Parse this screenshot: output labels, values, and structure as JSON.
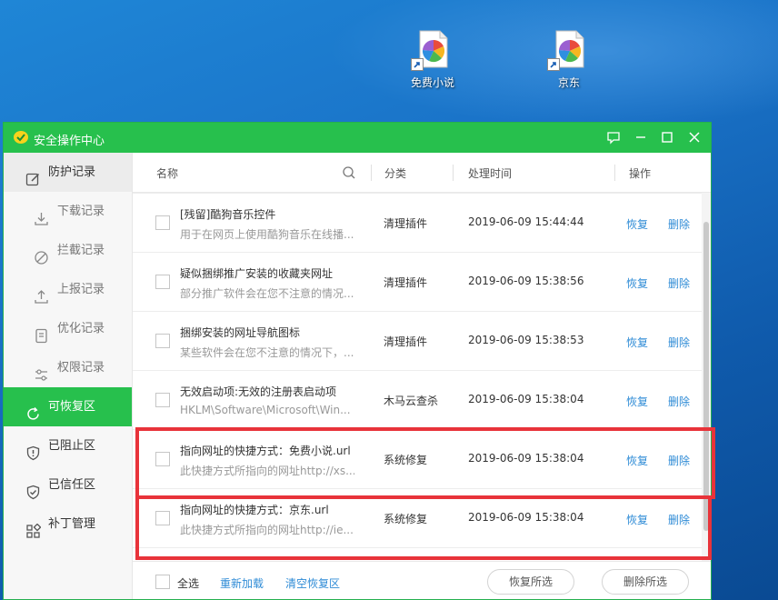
{
  "desktop": {
    "icons": [
      {
        "label": "免费小说"
      },
      {
        "label": "京东"
      }
    ]
  },
  "window": {
    "title": "安全操作中心"
  },
  "sidebar": {
    "items": [
      {
        "label": "防护记录",
        "icon": "shield-record-icon"
      },
      {
        "label": "下载记录",
        "icon": "download-icon"
      },
      {
        "label": "拦截记录",
        "icon": "block-icon"
      },
      {
        "label": "上报记录",
        "icon": "upload-icon"
      },
      {
        "label": "优化记录",
        "icon": "document-icon"
      },
      {
        "label": "权限记录",
        "icon": "sliders-icon"
      },
      {
        "label": "可恢复区",
        "icon": "restore-icon"
      },
      {
        "label": "已阻止区",
        "icon": "shield-alert-icon"
      },
      {
        "label": "已信任区",
        "icon": "shield-check-icon"
      },
      {
        "label": "补丁管理",
        "icon": "grid-icon"
      }
    ]
  },
  "table": {
    "headers": {
      "name": "名称",
      "category": "分类",
      "time": "处理时间",
      "action": "操作"
    },
    "restore_label": "恢复",
    "delete_label": "删除",
    "rows": [
      {
        "name": "[残留]酷狗音乐控件",
        "desc": "用于在网页上使用酷狗音乐在线播...",
        "category": "清理插件",
        "time": "2019-06-09 15:44:44"
      },
      {
        "name": "疑似捆绑推广安装的收藏夹网址",
        "desc": "部分推广软件会在您不注意的情况...",
        "category": "清理插件",
        "time": "2019-06-09 15:38:56"
      },
      {
        "name": "捆绑安装的网址导航图标",
        "desc": "某些软件会在您不注意的情况下，...",
        "category": "清理插件",
        "time": "2019-06-09 15:38:53"
      },
      {
        "name": "无效启动项:无效的注册表启动项",
        "desc": "HKLM\\Software\\Microsoft\\Win...",
        "category": "木马云查杀",
        "time": "2019-06-09 15:38:04"
      },
      {
        "name": "指向网址的快捷方式：免费小说.url",
        "desc": "此快捷方式所指向的网址http://xs....",
        "category": "系统修复",
        "time": "2019-06-09 15:38:04"
      },
      {
        "name": "指向网址的快捷方式：京东.url",
        "desc": "此快捷方式所指向的网址http://ie....",
        "category": "系统修复",
        "time": "2019-06-09 15:38:04"
      }
    ]
  },
  "footer": {
    "select_all": "全选",
    "reload": "重新加载",
    "clear": "清空恢复区",
    "restore_selected": "恢复所选",
    "delete_selected": "删除所选"
  },
  "colors": {
    "accent": "#27c04d",
    "link": "#2e8bd6",
    "highlight": "#e8333a"
  }
}
